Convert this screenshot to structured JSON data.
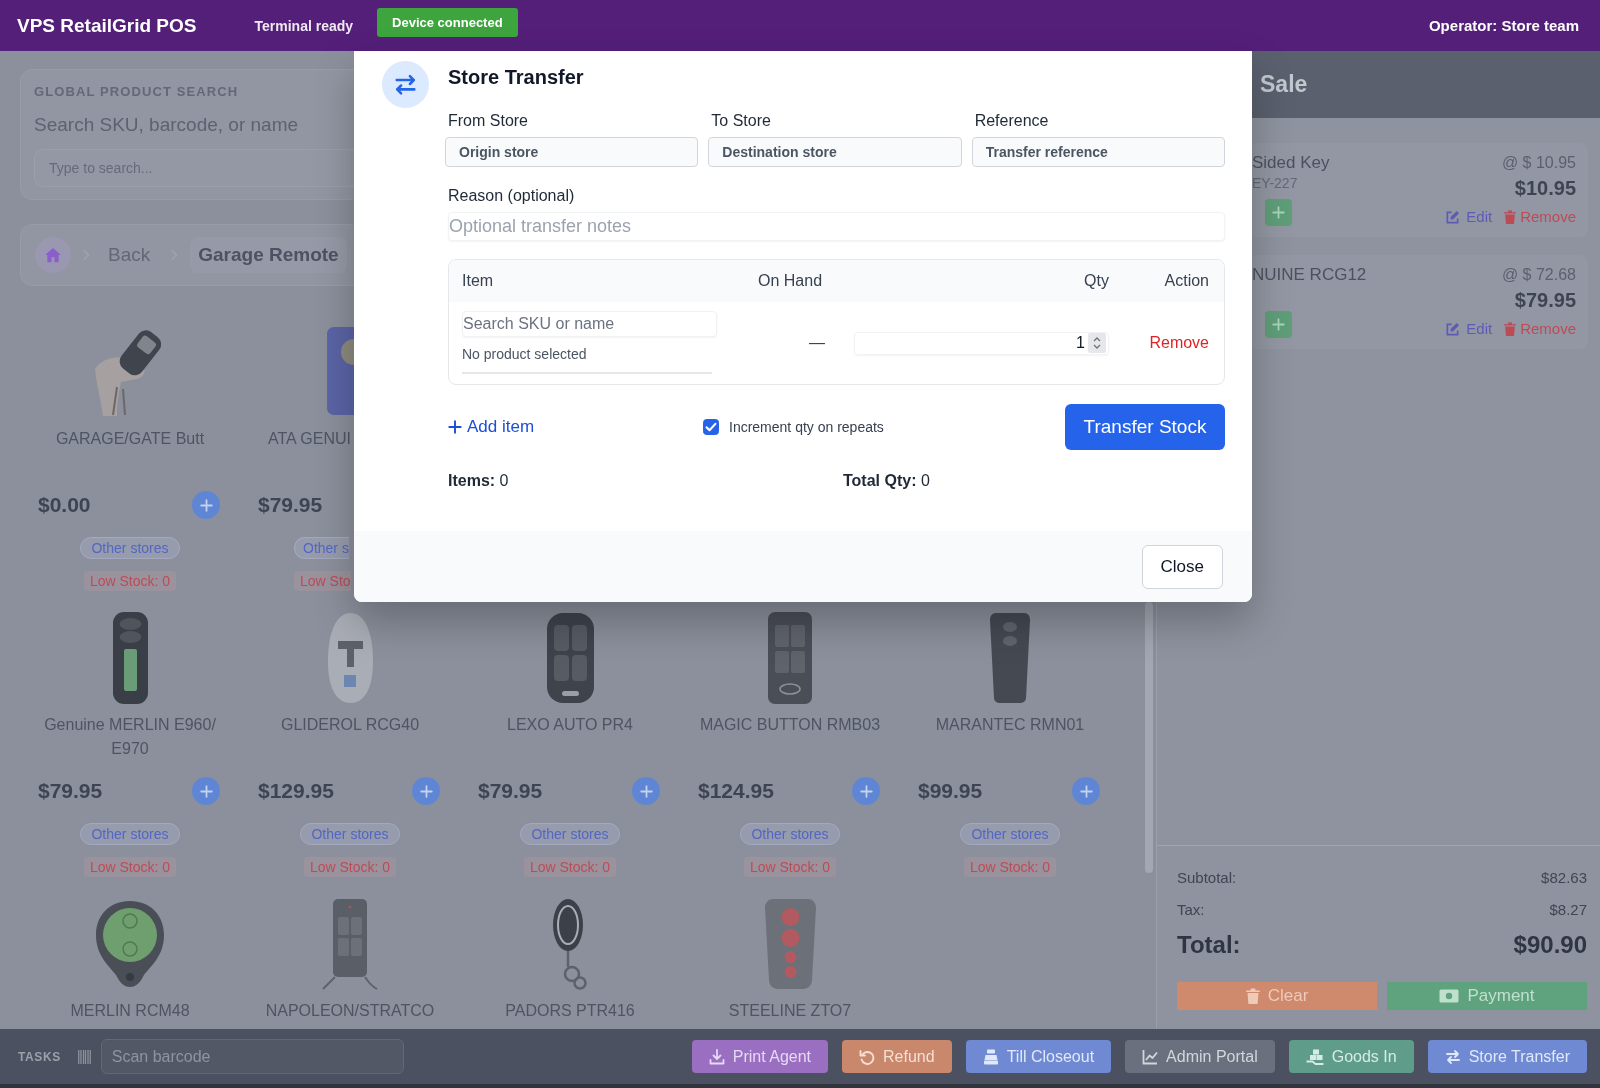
{
  "header": {
    "title": "VPS RetailGrid POS",
    "status": "Terminal ready",
    "device_badge": "Device connected",
    "operator": "Operator: Store team"
  },
  "search": {
    "label": "GLOBAL PRODUCT SEARCH",
    "heading": "Search SKU, barcode, or name",
    "field": {
      "placeholder": "Type to search..."
    }
  },
  "breadcrumb": {
    "back": "Back",
    "current": "Garage Remote"
  },
  "product_rows": [
    [
      {
        "name": "GARAGE/GATE Butt",
        "price": "$0.00",
        "other_stores": "Other stores",
        "stock": "Low Stock: 0",
        "covered": false
      },
      {
        "name": "ATA GENUI",
        "price": "$79.95",
        "other_stores": "Other s",
        "stock": "Low Sto",
        "covered": true
      }
    ],
    [
      {
        "name": "Genuine MERLIN E960/E970",
        "price": "$79.95",
        "other_stores": "Other stores",
        "stock": "Low Stock: 0",
        "covered": false
      },
      {
        "name": "GLIDEROL RCG40",
        "price": "$129.95",
        "other_stores": "Other stores",
        "stock": "Low Stock: 0",
        "covered": false
      },
      {
        "name": "LEXO AUTO PR4",
        "price": "$79.95",
        "other_stores": "Other stores",
        "stock": "Low Stock: 0",
        "covered": false
      },
      {
        "name": "MAGIC BUTTON RMB03",
        "price": "$124.95",
        "other_stores": "Other stores",
        "stock": "Low Stock: 0",
        "covered": false
      },
      {
        "name": "MARANTEC RMN01",
        "price": "$99.95",
        "other_stores": "Other stores",
        "stock": "Low Stock: 0",
        "covered": false
      }
    ],
    [
      {
        "name": "MERLIN RCM48",
        "covered": false
      },
      {
        "name": "NAPOLEON/STRATCO",
        "covered": false
      },
      {
        "name": "PADORS PTR416",
        "covered": false
      },
      {
        "name": "STEELINE ZTO7",
        "covered": false
      }
    ]
  ],
  "cart": {
    "title": "Sale",
    "items": [
      {
        "name": "Sided Key",
        "sku": "EY-227",
        "unit_price": "@ $ 10.95",
        "total": "$10.95",
        "edit": "Edit",
        "remove": "Remove"
      },
      {
        "name": "NUINE RCG12",
        "unit_price": "@ $ 72.68",
        "total": "$79.95",
        "edit": "Edit",
        "remove": "Remove"
      }
    ],
    "summary": [
      {
        "label": "Subtotal:",
        "value": "$82.63",
        "kind": "line"
      },
      {
        "label": "Tax:",
        "value": "$8.27",
        "kind": "line"
      },
      {
        "label": "Total:",
        "value": "$90.90",
        "kind": "grand"
      }
    ],
    "buttons": [
      {
        "label": "Clear",
        "kind": "clear"
      },
      {
        "label": "Payment",
        "kind": "payment"
      }
    ]
  },
  "task_bar": {
    "label": "TASKS",
    "scan_field": {
      "placeholder": "Scan barcode"
    },
    "buttons": [
      {
        "label": "Print Agent",
        "kind": "print"
      },
      {
        "label": "Refund",
        "kind": "refund"
      },
      {
        "label": "Till Closeout",
        "kind": "till"
      },
      {
        "label": "Admin Portal",
        "kind": "admin"
      },
      {
        "label": "Goods In",
        "kind": "goods"
      },
      {
        "label": "Store Transfer",
        "kind": "transfer"
      }
    ]
  },
  "dialog": {
    "title": "Store Transfer",
    "fields": [
      {
        "label": "From Store",
        "placeholder": "Origin store"
      },
      {
        "label": "To Store",
        "placeholder": "Destination store"
      },
      {
        "label": "Reference",
        "placeholder": "Transfer reference"
      }
    ],
    "reason": {
      "label": "Reason (optional)",
      "placeholder": "Optional transfer notes"
    },
    "table": {
      "columns": [
        "Item",
        "On Hand",
        "Qty",
        "Action"
      ],
      "rows": [
        {
          "search": {
            "placeholder": "Search SKU or name"
          },
          "status": "No product selected",
          "on_hand": "—",
          "qty": "1",
          "action": "Remove"
        }
      ]
    },
    "add_item": "Add item",
    "increment": {
      "label": "Increment qty on repeats",
      "checked": true
    },
    "submit": "Transfer Stock",
    "totals": [
      "**Items:** 0",
      "**Total Qty:** 0"
    ],
    "close": "Close"
  }
}
